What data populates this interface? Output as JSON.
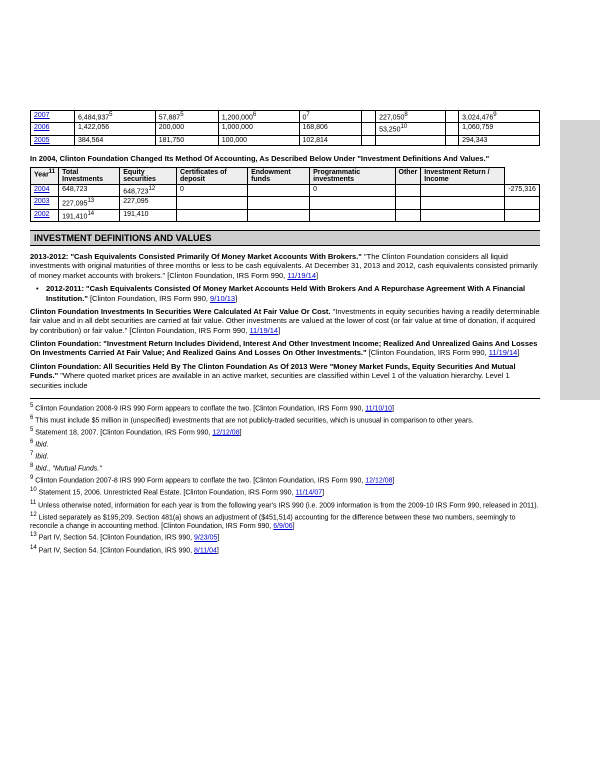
{
  "table1": {
    "rows": [
      {
        "year": "2007",
        "c1": "6,484,937",
        "s1": "5",
        "c2": "57,887",
        "s2": "5",
        "c3": "1,200,000",
        "s3": "6",
        "c4": "0",
        "s4": "7",
        "c5": "",
        "c6": "227,050",
        "s6": "8",
        "c7": "",
        "c8": "3,024,476",
        "s8": "9"
      },
      {
        "year": "2006",
        "c1": "1,422,056",
        "c2": "200,000",
        "c3": "1,000,000",
        "c4": "168,806",
        "c5": "",
        "c6": "53,250",
        "s6": "10",
        "c7": "",
        "c8": "1,060,759"
      },
      {
        "year": "2005",
        "c1": "384,564",
        "c2": "181,750",
        "c3": "100,000",
        "c4": "102,814",
        "c5": "",
        "c6": "",
        "c7": "",
        "c8": "294,343"
      }
    ]
  },
  "caption1": "In 2004, Clinton Foundation Changed Its Method Of Accounting, As Described Below Under \"Investment Definitions And Values.\"",
  "table2": {
    "headers": {
      "h0": "Year",
      "hs0": "11",
      "h1": "Total Investments",
      "h2": "Equity securities",
      "h3": "Certificates of deposit",
      "h4": "Endowment funds",
      "h5": "Programmatic investments",
      "h6": "Other",
      "h7": "Investment Return / Income"
    },
    "rows": [
      {
        "year": "2004",
        "c1": "648,723",
        "c2": "648,723",
        "s2": "12",
        "c3": "0",
        "c4": "",
        "c5": "0",
        "c6": "",
        "c7": "",
        "c8": "-275,316"
      },
      {
        "year": "2003",
        "c1": "227,095",
        "s1": "13",
        "c2": "227,095",
        "c3": "",
        "c4": "",
        "c5": "",
        "c6": "",
        "c7": "",
        "c8": ""
      },
      {
        "year": "2002",
        "c1": "191,410",
        "s1": "14",
        "c2": "191,410",
        "c3": "",
        "c4": "",
        "c5": "",
        "c6": "",
        "c7": "",
        "c8": ""
      }
    ]
  },
  "sectionTitle": "INVESTMENT DEFINITIONS AND VALUES",
  "p1a": "2013-2012: \"Cash Equivalents Consisted Primarily Of Money Market Accounts With Brokers.\"",
  "p1b": " \"The Clinton Foundation considers all liquid investments with original maturities of three months or less to be cash equivalents. At December 31, 2013 and 2012, cash equivalents consisted primarily of money market accounts with brokers.\" [Clinton Foundation, IRS Form 990, ",
  "p1link": "11/19/14",
  "p1c": "]",
  "p2a": "2012-2011: \"Cash Equivalents Consisted Of Money Market Accounts Held With Brokers And A Repurchase Agreement With A Financial Institution.\"",
  "p2b": " [Clinton Foundation, IRS Form 990, ",
  "p2link": "9/10/13",
  "p2c": "]",
  "p3a": "Clinton Foundation Investments In Securities Were Calculated At Fair Value Or Cost.",
  "p3b": " \"Investments in equity securities having a readily determinable fair value and in all debt securities are carried at fair value. Other investments are valued at the lower of cost (or fair value at time of donation, if acquired by contribution) or fair value.\" [Clinton Foundation, IRS Form 990, ",
  "p3link": "11/19/14",
  "p3c": "]",
  "p4a": "Clinton Foundation: \"Investment Return Includes Dividend, Interest And Other Investment Income; Realized And Unrealized Gains And Losses On Investments Carried At Fair Value; And Realized Gains And Losses On Other Investments.\"",
  "p4b": " [Clinton Foundation, IRS Form 990, ",
  "p4link": "11/19/14",
  "p4c": "]",
  "p5a": "Clinton Foundation: All Securities Held By The Clinton Foundation As Of 2013 Were \"Money Market Funds, Equity Securities And Mutual Funds.\"",
  "p5b": " \"Where quoted market prices are available in an active market, securities are classified within Level 1 of the valuation hierarchy. Level 1 securities include",
  "fn": {
    "f5a": " Clinton Foundation 2008-9 IRS 990 Form appears to conflate the two. [Clinton Foundation, IRS Form 990, ",
    "f5l": "11/10/10",
    "f5c": "]",
    "f6": " This must include $5 million in (unspecified) investments that are not publicly-traded securities, which is unusual in comparison to other years.",
    "f7a": " Statement 18, 2007. [Clinton Foundation, IRS Form 990, ",
    "f7l": "12/12/08",
    "f7c": "]",
    "f8": " Ibid.",
    "f9": " Ibid.",
    "f10": " Ibid., \"Mutual Funds.\"",
    "f11a": " Clinton Foundation 2007-8 IRS 990 Form appears to conflate the two. [Clinton Foundation, IRS Form 990, ",
    "f11l": "12/12/08",
    "f11c": "]",
    "f12a": " Statement 15, 2006. Unrestricted Real Estate. [Clinton Foundation, IRS Form 990, ",
    "f12l": "11/14/07",
    "f12c": "]",
    "f13": " Unless otherwise noted, information for each year is from the following year's IRS 990 (i.e. 2009 information is from the 2009-10 IRS Form 990, released in 2011).",
    "f14a": " Listed separately as $195,209. Section 481(a) shows an adjustment of ($451,514) accounting for the difference between these two numbers, seemingly to reconcile a change in accounting method. [Clinton Foundation, IRS Form 990, ",
    "f14l": "6/9/06",
    "f14c": "]",
    "f15a": " Part IV, Section 54. [Clinton Foundation, IRS 990, ",
    "f15l": "9/23/05",
    "f15c": "]",
    "f16a": " Part IV, Section 54. [Clinton Foundation, IRS 990, ",
    "f16l": "8/11/04",
    "f16c": "]"
  }
}
